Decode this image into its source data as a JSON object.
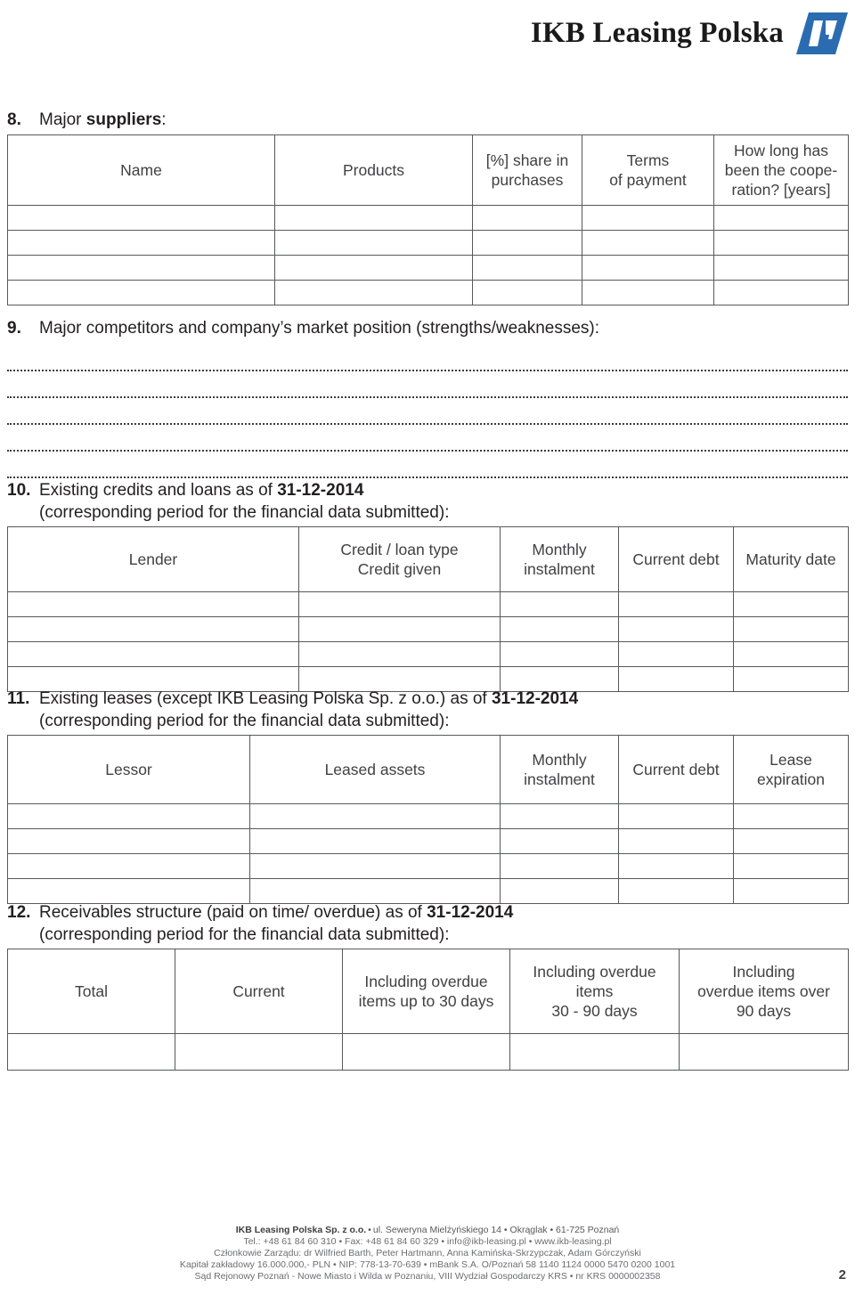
{
  "header": {
    "brand": "IKB Leasing Polska",
    "logo_color": "#2b6cb0",
    "logo_name": "ikb-parallelogram-logo"
  },
  "sections": [
    {
      "number": "8.",
      "title_prefix": "Major ",
      "title_bold": "suppliers",
      "title_suffix": ":",
      "table": {
        "headers": [
          "Name",
          "Products",
          "[%] share in\npurchases",
          "Terms\nof payment",
          "How long has\nbeen the coope-\nration? [years]"
        ],
        "rows": 4
      }
    },
    {
      "number": "9.",
      "title": "Major competitors and company’s market position (strengths/weaknesses):",
      "dotted_lines": 5
    },
    {
      "number": "10.",
      "title_prefix": "Existing credits and loans as of ",
      "title_bold": "31-12-2014",
      "subtitle": "(corresponding period for the financial data submitted):",
      "table": {
        "headers": [
          "Lender",
          "Credit / loan type\nCredit given",
          "Monthly\ninstalment",
          "Current debt",
          "Maturity date"
        ],
        "rows": 4
      }
    },
    {
      "number": "11.",
      "title_prefix": "Existing leases (except IKB Leasing Polska Sp. z o.o.) as of ",
      "title_bold": "31-12-2014",
      "subtitle": "(corresponding period for the financial data submitted):",
      "table": {
        "headers": [
          "Lessor",
          "Leased assets",
          "Monthly\ninstalment",
          "Current debt",
          "Lease\nexpiration"
        ],
        "rows": 4
      }
    },
    {
      "number": "12.",
      "title_prefix": "Receivables structure (paid on time/ overdue) as of ",
      "title_bold": "31-12-2014",
      "subtitle": "(corresponding period for the financial data submitted):",
      "table": {
        "headers": [
          "Total",
          "Current",
          "Including overdue\nitems up to 30 days",
          "Including overdue\nitems\n30 - 90 days",
          "Including\noverdue items over\n90 days"
        ],
        "rows": 1
      }
    }
  ],
  "footer": {
    "line1_bold": "IKB Leasing Polska Sp. z o.o.",
    "line1_rest": "ul. Seweryna Mielżyńskiego 14 • Okrąglak • 61-725 Poznań",
    "line2": "Tel.: +48 61 84 60 310 • Fax: +48 61 84 60 329 • info@ikb-leasing.pl • www.ikb-leasing.pl",
    "line3": "Członkowie Zarządu: dr Wilfried Barth, Peter Hartmann, Anna Kamińska-Skrzypczak, Adam Górczyński",
    "line4": "Kapitał zakładowy 16.000.000,- PLN • NIP: 778-13-70-639 • mBank S.A. O/Poznań 58 1140 1124 0000 5470 0200 1001",
    "line5": "Sąd Rejonowy Poznań - Nowe Miasto i Wilda w Poznaniu, VIII Wydział Gospodarczy KRS • nr KRS 0000002358",
    "page_number": "2"
  }
}
